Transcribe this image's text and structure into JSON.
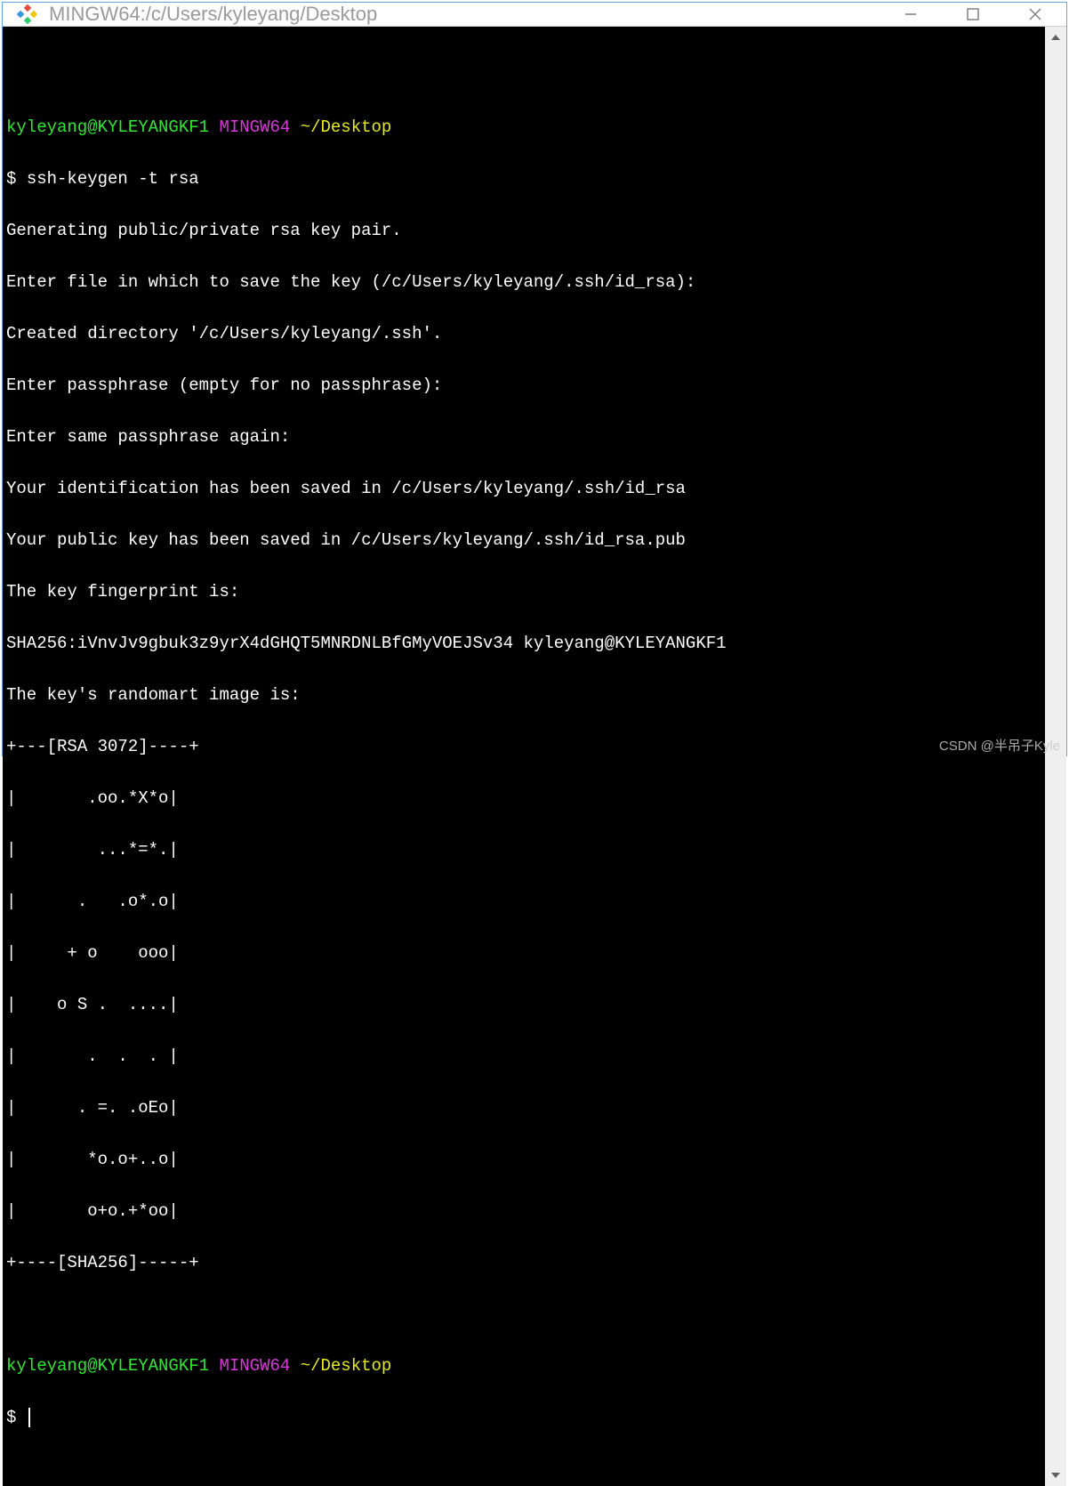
{
  "window": {
    "title": "MINGW64:/c/Users/kyleyang/Desktop"
  },
  "prompt1": {
    "user_host": "kyleyang@KYLEYANGKF1",
    "env": "MINGW64",
    "path": "~/Desktop",
    "symbol": "$ ",
    "command": "ssh-keygen -t rsa"
  },
  "output": {
    "l1": "Generating public/private rsa key pair.",
    "l2": "Enter file in which to save the key (/c/Users/kyleyang/.ssh/id_rsa):",
    "l3": "Created directory '/c/Users/kyleyang/.ssh'.",
    "l4": "Enter passphrase (empty for no passphrase):",
    "l5": "Enter same passphrase again:",
    "l6": "Your identification has been saved in /c/Users/kyleyang/.ssh/id_rsa",
    "l7": "Your public key has been saved in /c/Users/kyleyang/.ssh/id_rsa.pub",
    "l8": "The key fingerprint is:",
    "l9": "SHA256:iVnvJv9gbuk3z9yrX4dGHQT5MNRDNLBfGMyVOEJSv34 kyleyang@KYLEYANGKF1",
    "l10": "The key's randomart image is:",
    "art0": "+---[RSA 3072]----+",
    "art1": "|       .oo.*X*o|",
    "art2": "|        ...*=*.|",
    "art3": "|      .   .o*.o|",
    "art4": "|     + o    ooo|",
    "art5": "|    o S .  ....|",
    "art6": "|       .  .  . |",
    "art7": "|      . =. .oEo|",
    "art8": "|       *o.o+..o|",
    "art9": "|       o+o.+*oo|",
    "art10": "+----[SHA256]-----+"
  },
  "prompt2": {
    "user_host": "kyleyang@KYLEYANGKF1",
    "env": "MINGW64",
    "path": "~/Desktop",
    "symbol": "$ "
  },
  "watermark": "CSDN @半吊子Kyle"
}
